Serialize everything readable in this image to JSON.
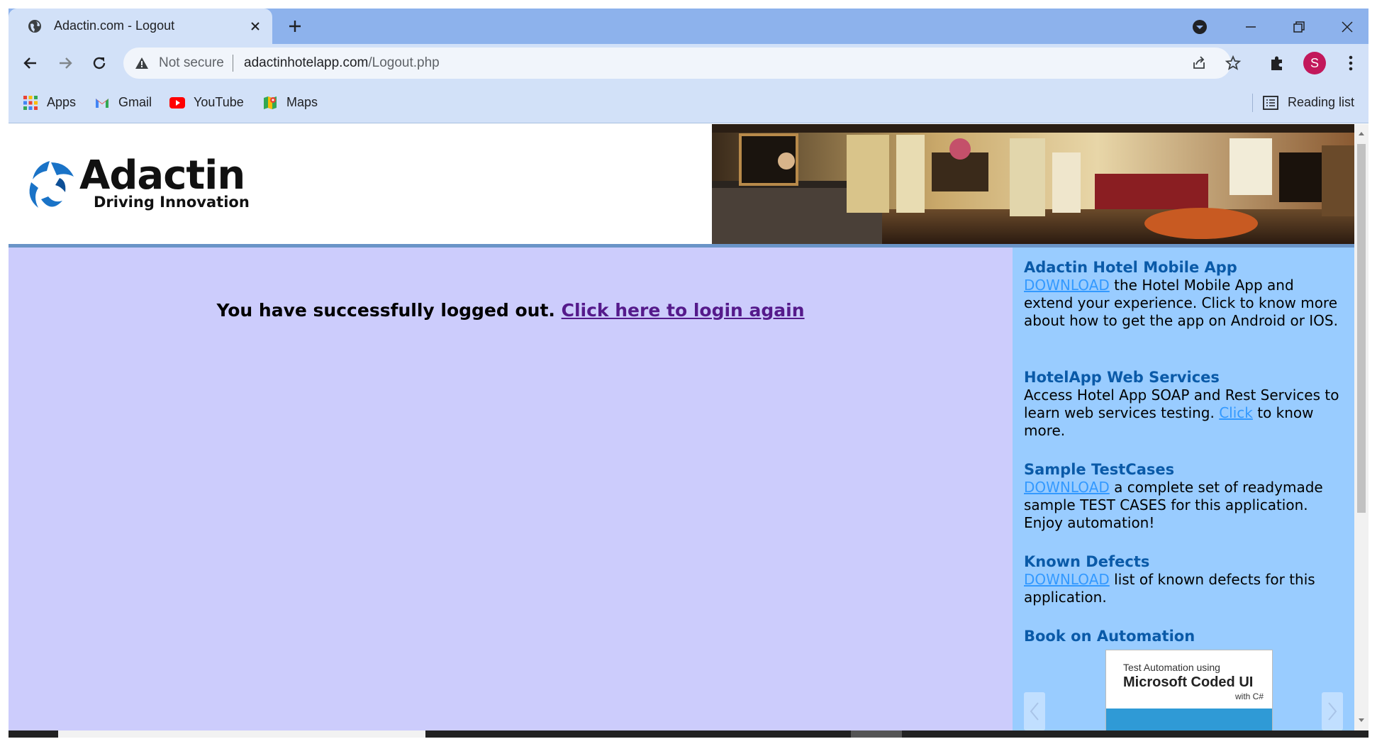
{
  "browser": {
    "tab_title": "Adactin.com - Logout",
    "omnibox": {
      "security_label": "Not secure",
      "url_host": "adactinhotelapp.com",
      "url_path": "/Logout.php"
    },
    "profile_initial": "S",
    "bookmarks": [
      {
        "label": "Apps",
        "icon": "apps-grid-icon"
      },
      {
        "label": "Gmail",
        "icon": "gmail-icon"
      },
      {
        "label": "YouTube",
        "icon": "youtube-icon"
      },
      {
        "label": "Maps",
        "icon": "maps-icon"
      }
    ],
    "reading_list_label": "Reading list"
  },
  "page": {
    "logo_word": "Adactin",
    "logo_tagline": "Driving Innovation",
    "logout": {
      "message": "You have successfully logged out.",
      "link_text": "Click here to login again"
    },
    "sidebar": {
      "mobile": {
        "heading": "Adactin Hotel Mobile App",
        "link": "DOWNLOAD",
        "text": " the Hotel Mobile App and extend your experience. Click to know more about how to get the app on Android or IOS."
      },
      "webservices": {
        "heading": "HotelApp Web Services",
        "text_before": "Access Hotel App SOAP and Rest Services to learn web services testing. ",
        "link": "Click",
        "text_after": " to know more."
      },
      "testcases": {
        "heading": "Sample TestCases",
        "link": "DOWNLOAD",
        "text": " a complete set of readymade sample TEST CASES for this application. Enjoy automation!"
      },
      "defects": {
        "heading": "Known Defects",
        "link": "DOWNLOAD",
        "text": " list of known defects for this application."
      },
      "book": {
        "heading": "Book on Automation",
        "line1": "Test Automation using",
        "line2": "Microsoft Coded UI",
        "line3": "with C#"
      }
    }
  },
  "colors": {
    "tabstrip": "#8db2ec",
    "toolbar": "#d2e1f8",
    "main_bg": "#ccccfc",
    "sidebar_bg": "#99ccff",
    "heading": "#0a5aa8",
    "link": "#3399ff",
    "visited_link": "#551a8b"
  }
}
